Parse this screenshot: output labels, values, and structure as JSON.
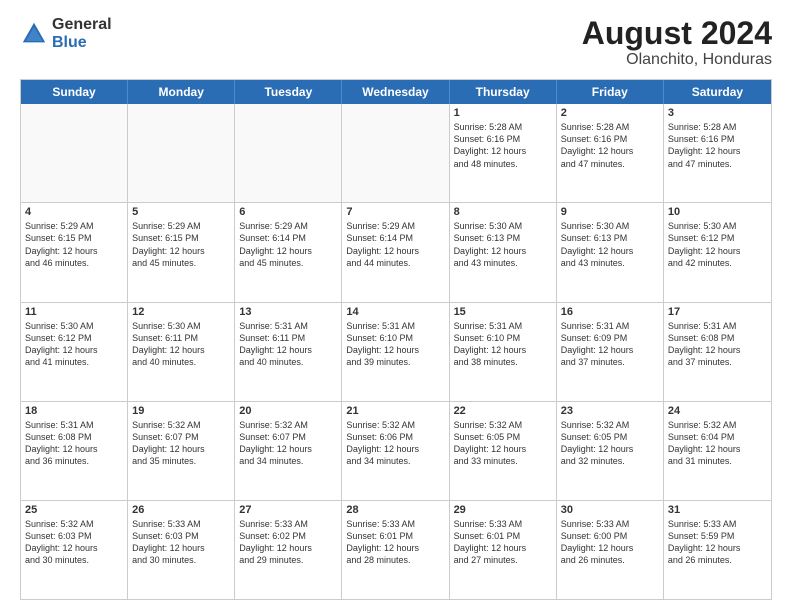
{
  "logo": {
    "general": "General",
    "blue": "Blue"
  },
  "title": "August 2024",
  "subtitle": "Olanchito, Honduras",
  "days": [
    "Sunday",
    "Monday",
    "Tuesday",
    "Wednesday",
    "Thursday",
    "Friday",
    "Saturday"
  ],
  "rows": [
    [
      {
        "day": "",
        "empty": true
      },
      {
        "day": "",
        "empty": true
      },
      {
        "day": "",
        "empty": true
      },
      {
        "day": "",
        "empty": true
      },
      {
        "day": "1",
        "lines": [
          "Sunrise: 5:28 AM",
          "Sunset: 6:16 PM",
          "Daylight: 12 hours",
          "and 48 minutes."
        ]
      },
      {
        "day": "2",
        "lines": [
          "Sunrise: 5:28 AM",
          "Sunset: 6:16 PM",
          "Daylight: 12 hours",
          "and 47 minutes."
        ]
      },
      {
        "day": "3",
        "lines": [
          "Sunrise: 5:28 AM",
          "Sunset: 6:16 PM",
          "Daylight: 12 hours",
          "and 47 minutes."
        ]
      }
    ],
    [
      {
        "day": "4",
        "lines": [
          "Sunrise: 5:29 AM",
          "Sunset: 6:15 PM",
          "Daylight: 12 hours",
          "and 46 minutes."
        ]
      },
      {
        "day": "5",
        "lines": [
          "Sunrise: 5:29 AM",
          "Sunset: 6:15 PM",
          "Daylight: 12 hours",
          "and 45 minutes."
        ]
      },
      {
        "day": "6",
        "lines": [
          "Sunrise: 5:29 AM",
          "Sunset: 6:14 PM",
          "Daylight: 12 hours",
          "and 45 minutes."
        ]
      },
      {
        "day": "7",
        "lines": [
          "Sunrise: 5:29 AM",
          "Sunset: 6:14 PM",
          "Daylight: 12 hours",
          "and 44 minutes."
        ]
      },
      {
        "day": "8",
        "lines": [
          "Sunrise: 5:30 AM",
          "Sunset: 6:13 PM",
          "Daylight: 12 hours",
          "and 43 minutes."
        ]
      },
      {
        "day": "9",
        "lines": [
          "Sunrise: 5:30 AM",
          "Sunset: 6:13 PM",
          "Daylight: 12 hours",
          "and 43 minutes."
        ]
      },
      {
        "day": "10",
        "lines": [
          "Sunrise: 5:30 AM",
          "Sunset: 6:12 PM",
          "Daylight: 12 hours",
          "and 42 minutes."
        ]
      }
    ],
    [
      {
        "day": "11",
        "lines": [
          "Sunrise: 5:30 AM",
          "Sunset: 6:12 PM",
          "Daylight: 12 hours",
          "and 41 minutes."
        ]
      },
      {
        "day": "12",
        "lines": [
          "Sunrise: 5:30 AM",
          "Sunset: 6:11 PM",
          "Daylight: 12 hours",
          "and 40 minutes."
        ]
      },
      {
        "day": "13",
        "lines": [
          "Sunrise: 5:31 AM",
          "Sunset: 6:11 PM",
          "Daylight: 12 hours",
          "and 40 minutes."
        ]
      },
      {
        "day": "14",
        "lines": [
          "Sunrise: 5:31 AM",
          "Sunset: 6:10 PM",
          "Daylight: 12 hours",
          "and 39 minutes."
        ]
      },
      {
        "day": "15",
        "lines": [
          "Sunrise: 5:31 AM",
          "Sunset: 6:10 PM",
          "Daylight: 12 hours",
          "and 38 minutes."
        ]
      },
      {
        "day": "16",
        "lines": [
          "Sunrise: 5:31 AM",
          "Sunset: 6:09 PM",
          "Daylight: 12 hours",
          "and 37 minutes."
        ]
      },
      {
        "day": "17",
        "lines": [
          "Sunrise: 5:31 AM",
          "Sunset: 6:08 PM",
          "Daylight: 12 hours",
          "and 37 minutes."
        ]
      }
    ],
    [
      {
        "day": "18",
        "lines": [
          "Sunrise: 5:31 AM",
          "Sunset: 6:08 PM",
          "Daylight: 12 hours",
          "and 36 minutes."
        ]
      },
      {
        "day": "19",
        "lines": [
          "Sunrise: 5:32 AM",
          "Sunset: 6:07 PM",
          "Daylight: 12 hours",
          "and 35 minutes."
        ]
      },
      {
        "day": "20",
        "lines": [
          "Sunrise: 5:32 AM",
          "Sunset: 6:07 PM",
          "Daylight: 12 hours",
          "and 34 minutes."
        ]
      },
      {
        "day": "21",
        "lines": [
          "Sunrise: 5:32 AM",
          "Sunset: 6:06 PM",
          "Daylight: 12 hours",
          "and 34 minutes."
        ]
      },
      {
        "day": "22",
        "lines": [
          "Sunrise: 5:32 AM",
          "Sunset: 6:05 PM",
          "Daylight: 12 hours",
          "and 33 minutes."
        ]
      },
      {
        "day": "23",
        "lines": [
          "Sunrise: 5:32 AM",
          "Sunset: 6:05 PM",
          "Daylight: 12 hours",
          "and 32 minutes."
        ]
      },
      {
        "day": "24",
        "lines": [
          "Sunrise: 5:32 AM",
          "Sunset: 6:04 PM",
          "Daylight: 12 hours",
          "and 31 minutes."
        ]
      }
    ],
    [
      {
        "day": "25",
        "lines": [
          "Sunrise: 5:32 AM",
          "Sunset: 6:03 PM",
          "Daylight: 12 hours",
          "and 30 minutes."
        ]
      },
      {
        "day": "26",
        "lines": [
          "Sunrise: 5:33 AM",
          "Sunset: 6:03 PM",
          "Daylight: 12 hours",
          "and 30 minutes."
        ]
      },
      {
        "day": "27",
        "lines": [
          "Sunrise: 5:33 AM",
          "Sunset: 6:02 PM",
          "Daylight: 12 hours",
          "and 29 minutes."
        ]
      },
      {
        "day": "28",
        "lines": [
          "Sunrise: 5:33 AM",
          "Sunset: 6:01 PM",
          "Daylight: 12 hours",
          "and 28 minutes."
        ]
      },
      {
        "day": "29",
        "lines": [
          "Sunrise: 5:33 AM",
          "Sunset: 6:01 PM",
          "Daylight: 12 hours",
          "and 27 minutes."
        ]
      },
      {
        "day": "30",
        "lines": [
          "Sunrise: 5:33 AM",
          "Sunset: 6:00 PM",
          "Daylight: 12 hours",
          "and 26 minutes."
        ]
      },
      {
        "day": "31",
        "lines": [
          "Sunrise: 5:33 AM",
          "Sunset: 5:59 PM",
          "Daylight: 12 hours",
          "and 26 minutes."
        ]
      }
    ]
  ]
}
